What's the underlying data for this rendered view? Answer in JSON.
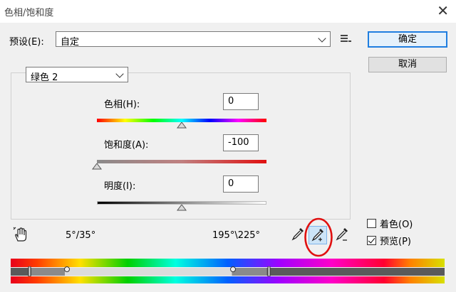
{
  "window": {
    "title": "色相/饱和度",
    "close_glyph": "✕"
  },
  "preset": {
    "label": "预设(E):",
    "value": "自定"
  },
  "buttons": {
    "ok": "确定",
    "cancel": "取消"
  },
  "channel": {
    "value": "绿色 2"
  },
  "hue": {
    "label": "色相(H):",
    "value": "0",
    "level": 0.5
  },
  "saturation": {
    "label": "饱和度(A):",
    "value": "-100",
    "level": 0.0
  },
  "lightness": {
    "label": "明度(I):",
    "value": "0",
    "level": 0.5
  },
  "range": {
    "left": "5°/35°",
    "right": "195°\\225°"
  },
  "options": {
    "colorize": {
      "label": "着色(O)",
      "checked": false
    },
    "preview": {
      "label": "预览(P)",
      "checked": true
    }
  },
  "icons": {
    "menu": "menu-icon",
    "hand": "targeted-adjustment-hand-icon",
    "eyedropper": "eyedropper-icon",
    "eyedropper_add": "eyedropper-add-icon",
    "eyedropper_subtract": "eyedropper-subtract-icon"
  },
  "colors": {
    "highlight_circle": "#e01010",
    "accent": "#1f7ee0"
  }
}
